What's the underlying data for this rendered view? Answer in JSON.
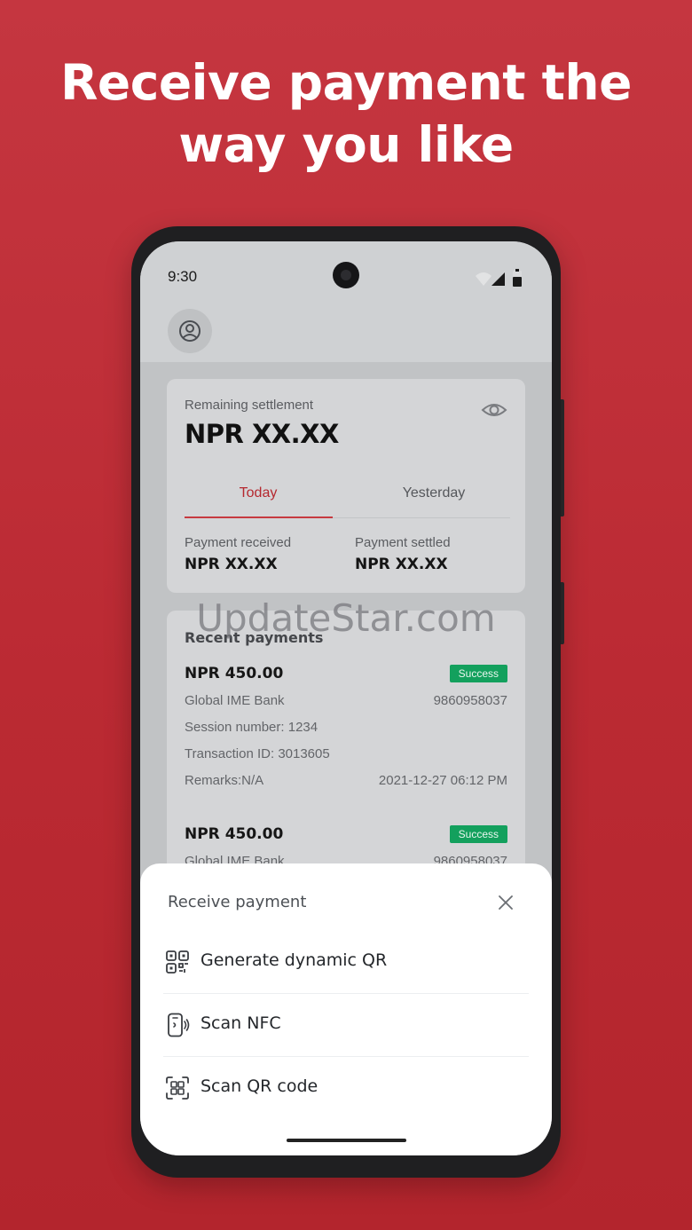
{
  "headline": {
    "line1": "Receive payment the",
    "line2": "way you like"
  },
  "status_bar": {
    "time": "9:30",
    "icons": [
      "wifi-icon",
      "signal-icon",
      "battery-icon"
    ]
  },
  "header": {
    "avatar_icon": "user-circle-icon"
  },
  "settlement": {
    "label": "Remaining settlement",
    "amount": "NPR XX.XX",
    "visibility_icon": "eye-icon",
    "tabs": [
      {
        "label": "Today",
        "active": true
      },
      {
        "label": "Yesterday",
        "active": false
      }
    ],
    "received_label": "Payment received",
    "received_value": "NPR XX.XX",
    "settled_label": "Payment settled",
    "settled_value": "NPR XX.XX"
  },
  "recent": {
    "title": "Recent payments",
    "items": [
      {
        "amount": "NPR 450.00",
        "status": "Success",
        "bank": "Global IME Bank",
        "phone": "9860958037",
        "session": "Session number: 1234",
        "transaction": "Transaction ID: 3013605",
        "remarks": "Remarks:N/A",
        "datetime": "2021-12-27 06:12 PM"
      },
      {
        "amount": "NPR 450.00",
        "status": "Success",
        "bank": "Global IME Bank",
        "phone": "9860958037"
      }
    ]
  },
  "watermark": "UpdateStar.com",
  "sheet": {
    "title": "Receive payment",
    "close_icon": "close-icon",
    "options": [
      {
        "label": "Generate dynamic QR",
        "icon": "qr-code-icon"
      },
      {
        "label": "Scan NFC",
        "icon": "nfc-phone-icon"
      },
      {
        "label": "Scan QR code",
        "icon": "scan-qr-icon"
      }
    ]
  },
  "colors": {
    "background": "#c0303a",
    "accent": "#b5282f",
    "success": "#13a05d"
  }
}
